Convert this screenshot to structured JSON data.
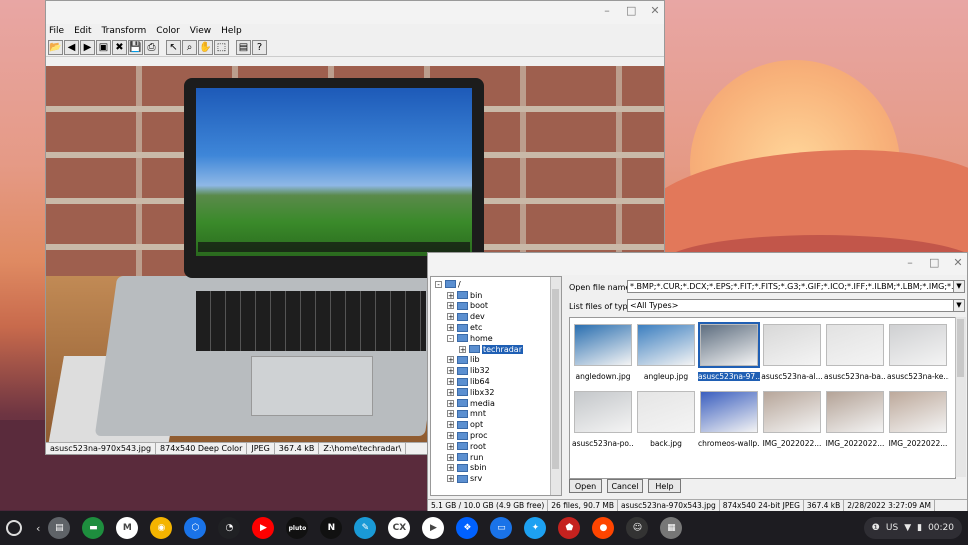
{
  "viewer": {
    "menu": [
      "File",
      "Edit",
      "Transform",
      "Color",
      "View",
      "Help"
    ],
    "toolbar_icons": [
      "open-icon",
      "prev-icon",
      "next-icon",
      "slideshow-icon",
      "delete-icon",
      "save-icon",
      "print-icon",
      "pointer-icon",
      "zoom-icon",
      "hand-icon",
      "select-icon",
      "properties-icon",
      "help-icon"
    ],
    "status": [
      "asusc523na-970x543.jpg",
      "874x540 Deep Color",
      "JPEG",
      "367.4 kB",
      "Z:\\home\\techradar\\"
    ]
  },
  "dialog": {
    "tree": [
      {
        "name": "/",
        "level": 0,
        "sign": "-"
      },
      {
        "name": "bin",
        "level": 1,
        "sign": "+"
      },
      {
        "name": "boot",
        "level": 1,
        "sign": "+"
      },
      {
        "name": "dev",
        "level": 1,
        "sign": "+"
      },
      {
        "name": "etc",
        "level": 1,
        "sign": "+"
      },
      {
        "name": "home",
        "level": 1,
        "sign": "-"
      },
      {
        "name": "techradar",
        "level": 2,
        "sign": "+",
        "selected": true
      },
      {
        "name": "lib",
        "level": 1,
        "sign": "+"
      },
      {
        "name": "lib32",
        "level": 1,
        "sign": "+"
      },
      {
        "name": "lib64",
        "level": 1,
        "sign": "+"
      },
      {
        "name": "libx32",
        "level": 1,
        "sign": "+"
      },
      {
        "name": "media",
        "level": 1,
        "sign": "+"
      },
      {
        "name": "mnt",
        "level": 1,
        "sign": "+"
      },
      {
        "name": "opt",
        "level": 1,
        "sign": "+"
      },
      {
        "name": "proc",
        "level": 1,
        "sign": "+"
      },
      {
        "name": "root",
        "level": 1,
        "sign": "+"
      },
      {
        "name": "run",
        "level": 1,
        "sign": "+"
      },
      {
        "name": "sbin",
        "level": 1,
        "sign": "+"
      },
      {
        "name": "srv",
        "level": 1,
        "sign": "+"
      }
    ],
    "open_file_name_label": "Open file name",
    "open_file_name_value": "*.BMP;*.CUR;*.DCX;*.EPS;*.FIT;*.FITS;*.G3;*.GIF;*.ICO;*.IFF;*.ILBM;*.LBM;*.IMG;*.JPG;*.JPEG;",
    "file_type_label": "List files of type",
    "file_type_value": "<All Types>",
    "thumbs": [
      {
        "name": "angledown.jpg",
        "color": "#2a6fb0"
      },
      {
        "name": "angleup.jpg",
        "color": "#3c7fc0"
      },
      {
        "name": "asusc523na-97...",
        "color": "#5e6e80",
        "selected": true
      },
      {
        "name": "asusc523na-al...",
        "color": "#d8d8d8"
      },
      {
        "name": "asusc523na-ba...",
        "color": "#e2e2e2"
      },
      {
        "name": "asusc523na-ke...",
        "color": "#cfd0d2"
      },
      {
        "name": "asusc523na-po...",
        "color": "#c4c7ca"
      },
      {
        "name": "back.jpg",
        "color": "#e5e5e5"
      },
      {
        "name": "chromeos-wallp...",
        "color": "#3b5fbf"
      },
      {
        "name": "IMG_2022022...",
        "color": "#b7a69a"
      },
      {
        "name": "IMG_2022022...",
        "color": "#b4a397"
      },
      {
        "name": "IMG_2022022...",
        "color": "#bda99b"
      }
    ],
    "buttons": {
      "open": "Open",
      "cancel": "Cancel",
      "help": "Help"
    },
    "status": [
      "5.1 GB / 10.0 GB (4.9 GB free)",
      "26 files, 90.7 MB",
      "asusc523na-970x543.jpg",
      "874x540 24-bit JPEG",
      "367.4 kB",
      "2/28/2022 3:27:09 AM"
    ]
  },
  "shelf": {
    "apps": [
      {
        "name": "files-app-icon",
        "color": "#5f6368",
        "glyph": "▤"
      },
      {
        "name": "chat-app-icon",
        "color": "#1e8e3e",
        "glyph": "▬"
      },
      {
        "name": "gmail-app-icon",
        "color": "#ffffff",
        "glyph": "M"
      },
      {
        "name": "chrome-app-icon",
        "color": "#f4b400",
        "glyph": "◉"
      },
      {
        "name": "vpn-app-icon",
        "color": "#1a73e8",
        "glyph": "⬡"
      },
      {
        "name": "speedtest-app-icon",
        "color": "#202124",
        "glyph": "◔"
      },
      {
        "name": "youtube-app-icon",
        "color": "#ff0000",
        "glyph": "▶"
      },
      {
        "name": "pluto-tv-app-icon",
        "color": "#111111",
        "glyph": "pluto"
      },
      {
        "name": "netflix-app-icon",
        "color": "#111111",
        "glyph": "N"
      },
      {
        "name": "feather-app-icon",
        "color": "#1a9ad6",
        "glyph": "✎"
      },
      {
        "name": "crossover-app-icon",
        "color": "#ffffff",
        "glyph": "CX"
      },
      {
        "name": "play-store-app-icon",
        "color": "#ffffff",
        "glyph": "▶"
      },
      {
        "name": "dropbox-app-icon",
        "color": "#0061ff",
        "glyph": "❖"
      },
      {
        "name": "messages-app-icon",
        "color": "#1a73e8",
        "glyph": "▭"
      },
      {
        "name": "twitter-app-icon",
        "color": "#1da1f2",
        "glyph": "✦"
      },
      {
        "name": "shield-app-icon",
        "color": "#c5221f",
        "glyph": "⬟"
      },
      {
        "name": "reddit-app-icon",
        "color": "#ff4500",
        "glyph": "●"
      },
      {
        "name": "linux-app-icon",
        "color": "#333333",
        "glyph": "☺"
      },
      {
        "name": "viewer-app-icon",
        "color": "#777777",
        "glyph": "▦"
      }
    ],
    "tray": {
      "locale": "US",
      "time": "00:20"
    }
  }
}
